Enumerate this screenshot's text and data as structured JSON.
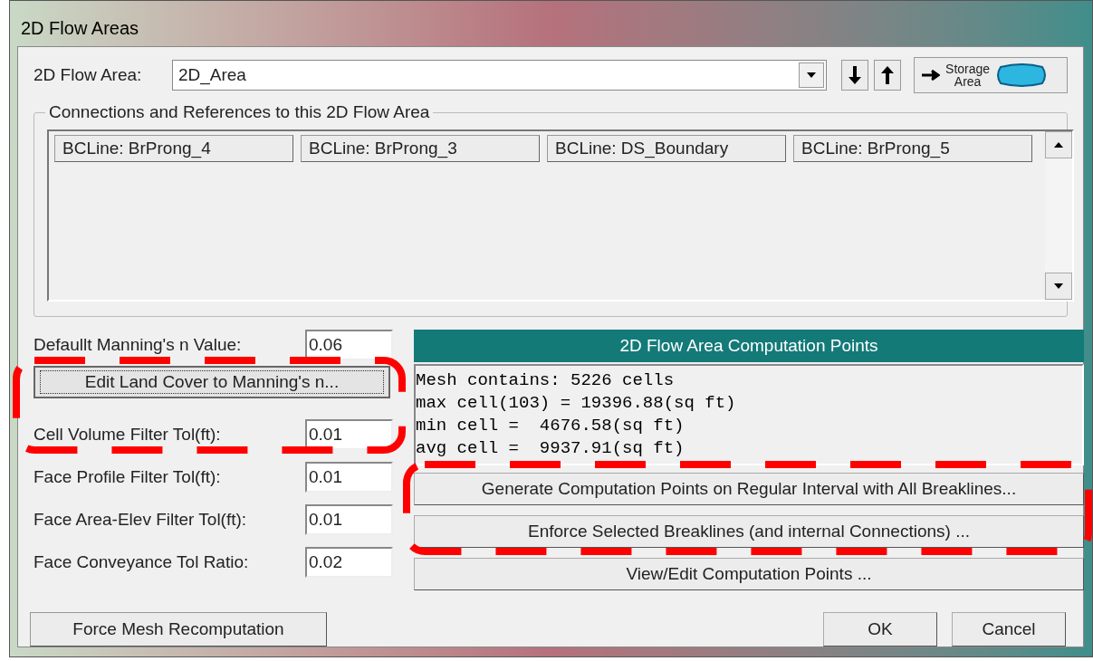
{
  "window": {
    "title": "2D Flow Areas"
  },
  "flow_area": {
    "label": "2D Flow Area:",
    "value": "2D_Area"
  },
  "nav_buttons": [
    {
      "kind": "down"
    },
    {
      "kind": "up"
    }
  ],
  "storage_button": {
    "label_lines": [
      "Storage",
      "Area"
    ]
  },
  "connections": {
    "title": "Connections and References to this 2D Flow Area",
    "items": [
      "BCLine: BrProng_4",
      "BCLine: BrProng_3",
      "BCLine: DS_Boundary",
      "BCLine: BrProng_5"
    ]
  },
  "parameters": [
    {
      "kind": "field",
      "label": "Defaullt Manning's n Value:",
      "value": "0.06"
    },
    {
      "kind": "button",
      "label": "Edit Land Cover to Manning's n..."
    },
    {
      "kind": "field",
      "label": "Cell Volume Filter Tol(ft):",
      "value": "0.01"
    },
    {
      "kind": "field",
      "label": "Face Profile Filter Tol(ft):",
      "value": "0.01"
    },
    {
      "kind": "field",
      "label": "Face Area-Elev Filter Tol(ft):",
      "value": "0.01"
    },
    {
      "kind": "field",
      "label": "Face Conveyance Tol Ratio:",
      "value": "0.02"
    }
  ],
  "computation": {
    "title": "2D Flow Area Computation Points",
    "log": [
      "Mesh contains: 5226 cells",
      "max cell(103) = 19396.88(sq ft)",
      "min cell =  4676.58(sq ft)",
      "avg cell =  9937.91(sq ft)"
    ],
    "buttons": [
      "Generate Computation Points on Regular Interval with All Breaklines...",
      "Enforce Selected Breaklines (and internal Connections) ...",
      "View/Edit Computation Points ..."
    ]
  },
  "footer": {
    "left_button": "Force Mesh Recomputation",
    "buttons": [
      "OK",
      "Cancel"
    ]
  }
}
